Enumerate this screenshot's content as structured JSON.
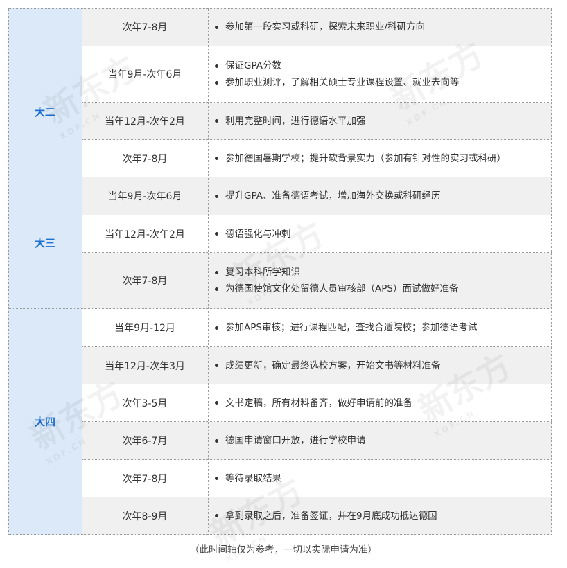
{
  "timeline": {
    "grades": [
      {
        "label": "",
        "rows": [
          0
        ]
      },
      {
        "label": "大二",
        "rows": [
          1,
          2,
          3
        ]
      },
      {
        "label": "大三",
        "rows": [
          4,
          5,
          6
        ]
      },
      {
        "label": "大四",
        "rows": [
          7,
          8,
          9,
          10,
          11,
          12
        ]
      }
    ],
    "rows": [
      {
        "period": "次年7-8月",
        "items": [
          "参加第一段实习或科研，探索未来职业/科研方向"
        ]
      },
      {
        "period": "当年9月-次年6月",
        "items": [
          "保证GPA分数",
          "参加职业测评，了解相关硕士专业课程设置、就业去向等"
        ]
      },
      {
        "period": "当年12月-次年2月",
        "items": [
          "利用完整时间，进行德语水平加强"
        ]
      },
      {
        "period": "次年7-8月",
        "items": [
          "参加德国暑期学校；提升软背景实力（参加有针对性的实习或科研）"
        ]
      },
      {
        "period": "当年9月-次年6月",
        "items": [
          "提升GPA、准备德语考试，增加海外交换或科研经历"
        ]
      },
      {
        "period": "当年12月-次年2月",
        "items": [
          "德语强化与冲刺"
        ]
      },
      {
        "period": "次年7-8月",
        "items": [
          "复习本科所学知识",
          "为德国使馆文化处留德人员审核部（APS）面试做好准备"
        ]
      },
      {
        "period": "当年9月-12月",
        "items": [
          "参加APS审核；进行课程匹配，查找合适院校；参加德语考试"
        ]
      },
      {
        "period": "当年12月-次年3月",
        "items": [
          "成绩更新，确定最终选校方案，开始文书等材料准备"
        ]
      },
      {
        "period": "次年3-5月",
        "items": [
          "文书定稿，所有材料备齐，做好申请前的准备"
        ]
      },
      {
        "period": "次年6-7月",
        "items": [
          "德国申请窗口开放，进行学校申请"
        ]
      },
      {
        "period": "次年7-8月",
        "items": [
          "等待录取结果"
        ]
      },
      {
        "period": "次年8-9月",
        "items": [
          "拿到录取之后，准备签证，并在9月底成功抵达德国"
        ]
      }
    ]
  },
  "footnote": "（此时间轴仅为参考，一切以实际申请为准）",
  "watermark": {
    "brand": "新东方",
    "domain": "XDF.CN"
  },
  "colors": {
    "grade_bg": "#dbe9f8",
    "grade_text": "#1d6fd0",
    "shade": "#f0f0f0"
  }
}
